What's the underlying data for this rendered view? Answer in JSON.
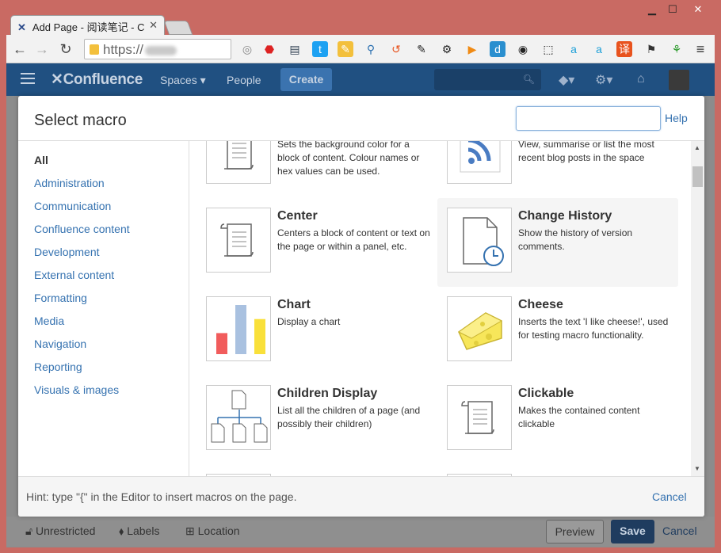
{
  "browser": {
    "tab_title": "Add Page - 阅读笔记 - C",
    "url_prefix": "https://",
    "winctl": {
      "minimize": "▁",
      "maximize": "☐",
      "close": "✕"
    }
  },
  "confluence": {
    "logo": "Confluence",
    "nav": {
      "spaces": "Spaces ▾",
      "people": "People"
    },
    "create_label": "Create"
  },
  "dialog": {
    "title": "Select macro",
    "search": {
      "placeholder": "",
      "value": ""
    },
    "help_label": "Help",
    "categories": [
      "All",
      "Administration",
      "Communication",
      "Confluence content",
      "Development",
      "External content",
      "Formatting",
      "Media",
      "Navigation",
      "Reporting",
      "Visuals & images"
    ],
    "macros": [
      {
        "name": "",
        "desc": "Sets the background color for a block of content. Colour names or hex values can be used.",
        "icon": "scroll-icon"
      },
      {
        "name": "",
        "desc": "View, summarise or list the most recent blog posts in the space",
        "icon": "rss-icon"
      },
      {
        "name": "Center",
        "desc": "Centers a block of content or text on the page or within a panel, etc.",
        "icon": "scroll-icon"
      },
      {
        "name": "Change History",
        "desc": "Show the history of version comments.",
        "icon": "document-clock-icon"
      },
      {
        "name": "Chart",
        "desc": "Display a chart",
        "icon": "bar-chart-icon"
      },
      {
        "name": "Cheese",
        "desc": "Inserts the text 'I like cheese!', used for testing macro functionality.",
        "icon": "cheese-icon"
      },
      {
        "name": "Children Display",
        "desc": "List all the children of a page (and possibly their children)",
        "icon": "page-tree-icon"
      },
      {
        "name": "Clickable",
        "desc": "Makes the contained content clickable",
        "icon": "scroll-icon"
      }
    ],
    "hint": "Hint: type \"{\" in the Editor to insert macros on the page.",
    "cancel_label": "Cancel"
  },
  "footer": {
    "restriction": "Unrestricted",
    "labels": "Labels",
    "location": "Location",
    "preview": "Preview",
    "save": "Save",
    "cancel": "Cancel"
  },
  "colors": {
    "header": "#205081",
    "link": "#3572b0",
    "save": "#205081",
    "chart_bars": [
      "#f15c5c",
      "#a9c1e0",
      "#f9e03a"
    ]
  },
  "icon_chart": {
    "type": "bar",
    "values": [
      3,
      7,
      5
    ]
  }
}
